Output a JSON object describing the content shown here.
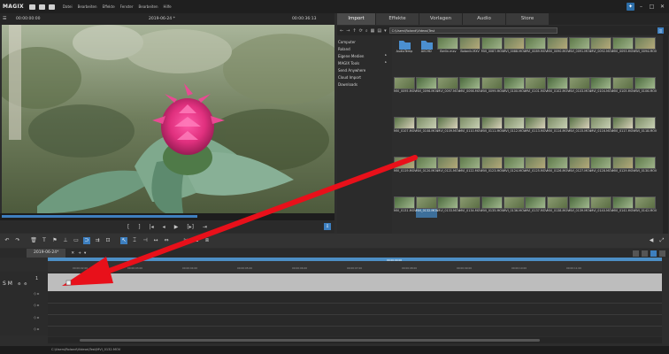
{
  "menubar": {
    "logo": "MAGIX",
    "items": [
      "Datei",
      "Bearbeiten",
      "Effekte",
      "Fenster",
      "Bearbeiten",
      "Hilfe"
    ]
  },
  "preview": {
    "time_left": "00:00:00:00",
    "title": "2019-06-24 *",
    "time_right": "00:00:36:13",
    "scrub_progress": 0.59
  },
  "transport": [
    "[",
    "]",
    "|◂",
    "◂",
    "▶",
    "[▸]",
    "⇥"
  ],
  "browser": {
    "tabs": [
      "Import",
      "Effekte",
      "Vorlagen",
      "Audio",
      "Store"
    ],
    "active_tab": 0,
    "path": "C:\\Users\\Roland\\Videos\\Test",
    "sidebar": [
      {
        "label": "Computer",
        "arrow": false
      },
      {
        "label": "Roland",
        "arrow": false
      },
      {
        "label": "Eigene Medien",
        "arrow": true
      },
      {
        "label": "MAGIX Tools",
        "arrow": true
      },
      {
        "label": "Send Anywhere",
        "arrow": false
      },
      {
        "label": "Cloud Import",
        "arrow": false
      },
      {
        "label": "Downloads",
        "arrow": false
      }
    ],
    "rows": [
      [
        "AudioTemp",
        "AVCHD",
        "Berlin.mxv",
        "Botanik.MXV",
        "MVI_0087.MOV",
        "MVI_0088.MOV",
        "MVI_0089.MOV",
        "MVI_0090.MOV",
        "MVI_0091.MOV",
        "MVI_0092.MOV",
        "MVI_0093.MOV",
        "MVI_0094.MOV"
      ],
      [
        "MVI_0095.MOV",
        "MVI_0096.MOV",
        "MVI_0097.MOV",
        "MVI_0098.MOV",
        "MVI_0099.MOV",
        "MVI_0100.MOV",
        "MVI_0101.MOV",
        "MVI_0102.MOV",
        "MVI_0103.MOV",
        "MVI_0104.MOV",
        "MVI_0105.MOV",
        "MVI_0106.MOV"
      ],
      [
        "MVI_0107.MOV",
        "MVI_0108.MOV",
        "MVI_0109.MOV",
        "MVI_0110.MOV",
        "MVI_0111.MOV",
        "MVI_0112.MOV",
        "MVI_0113.MOV",
        "MVI_0114.MOV",
        "MVI_0115.MOV",
        "MVI_0116.MOV",
        "MVI_0117.MOV",
        "MVI_0118.MOV"
      ],
      [
        "MVI_0119.MOV",
        "MVI_0120.MOV",
        "MVI_0121.MOV",
        "MVI_0122.MOV",
        "MVI_0123.MOV",
        "MVI_0124.MOV",
        "MVI_0125.MOV",
        "MVI_0126.MOV",
        "MVI_0127.MOV",
        "MVI_0128.MOV",
        "MVI_0129.MOV",
        "MVI_0130.MOV"
      ],
      [
        "MVI_0131.MOV",
        "MVI_0132.MOV",
        "MVI_0133.MOV",
        "MVI_0134.MOV",
        "MVI_0135.MOV",
        "MVI_0136.MOV",
        "MVI_0137.MOV",
        "MVI_0138.MOV",
        "MVI_0139.MOV",
        "MVI_0140.MOV",
        "MVI_0141.MOV",
        "MVI_0142.MOV"
      ]
    ],
    "selected": "MVI_0132.MOV"
  },
  "timeline": {
    "project_tab": "2019-06-24*",
    "ruler_center": "00:00:00:00",
    "ticks": [
      "00:00:02:00",
      "00:00:03:00",
      "00:00:04:00",
      "00:00:05:00",
      "00:00:06:00",
      "00:00:07:00",
      "00:00:08:00",
      "00:00:09:00",
      "00:00:10:00",
      "00:00:11:00"
    ],
    "track_header_label": "S M"
  },
  "status": {
    "text": "C:\\Users\\Roland\\Videos\\Test\\MVI_0132.MOV"
  },
  "colors": {
    "accent": "#3d7fbf",
    "arrow": "#e8101a"
  }
}
